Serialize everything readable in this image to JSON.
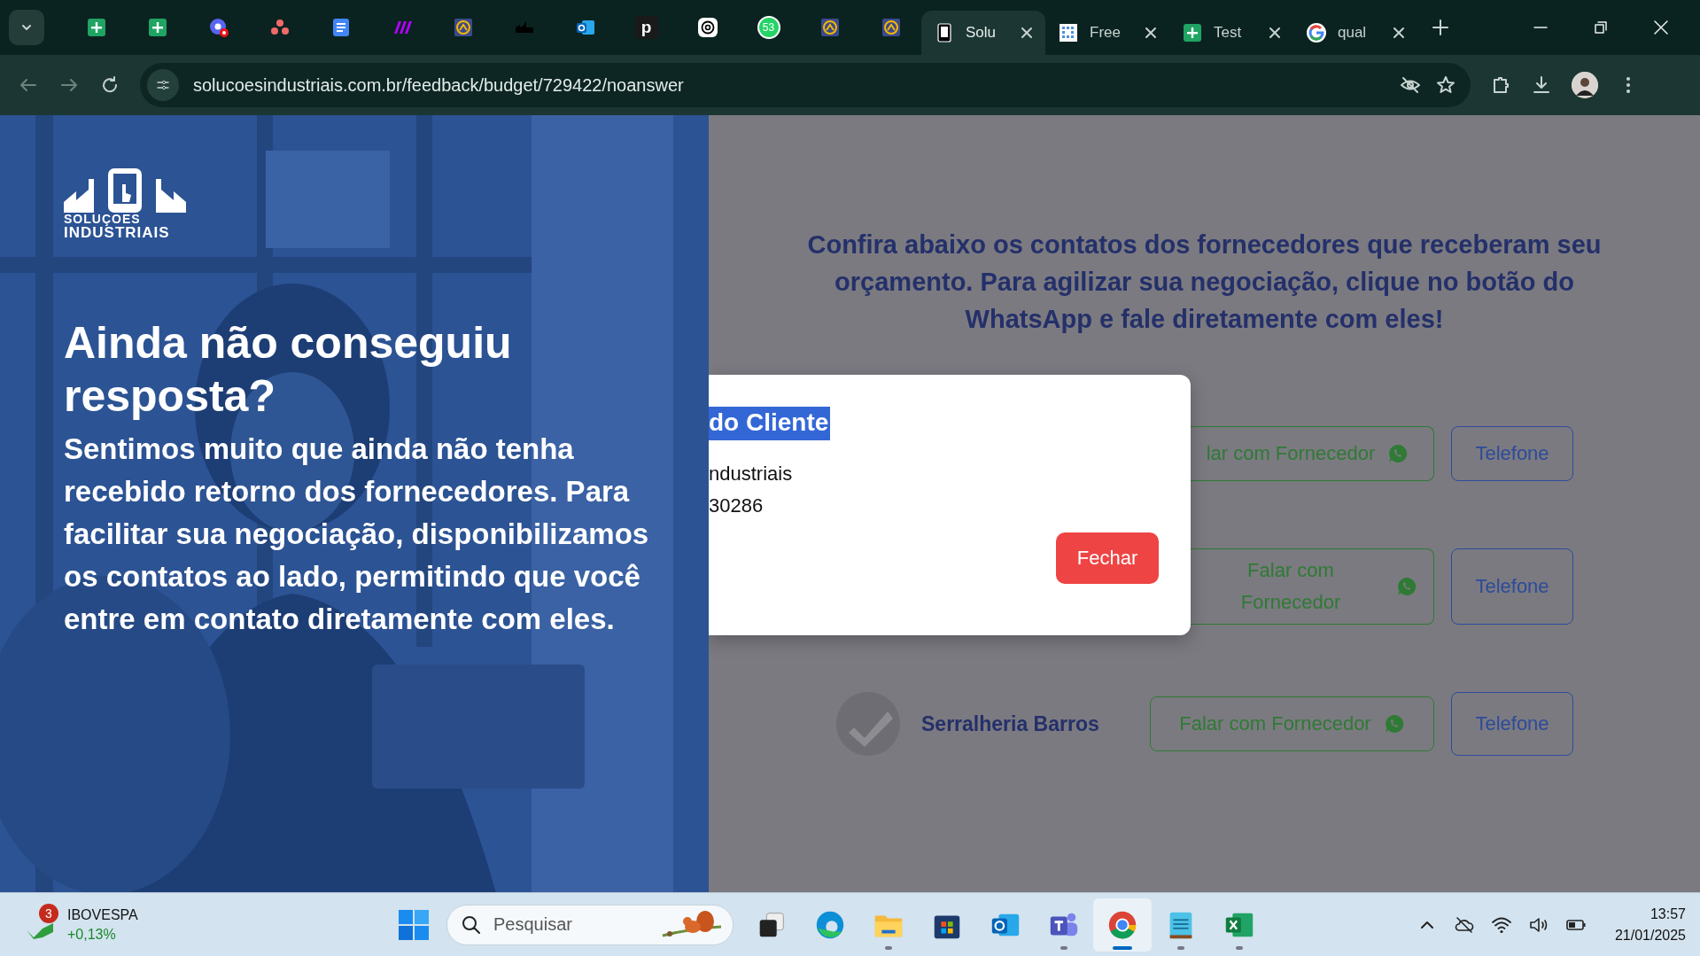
{
  "browser": {
    "pinned_tabs": [
      {
        "kind": "sheet"
      },
      {
        "kind": "sheet"
      },
      {
        "kind": "chat-alert"
      },
      {
        "kind": "dots"
      },
      {
        "kind": "doc"
      },
      {
        "kind": "stripes"
      },
      {
        "kind": "gauge"
      },
      {
        "kind": "factory"
      },
      {
        "kind": "mail"
      },
      {
        "kind": "letter",
        "label": "p"
      },
      {
        "kind": "knot"
      },
      {
        "kind": "bubble",
        "label": "53"
      },
      {
        "kind": "gauge"
      },
      {
        "kind": "gauge"
      }
    ],
    "tabs": [
      {
        "kind": "phone",
        "title": "Solu",
        "selected": true
      },
      {
        "kind": "grid",
        "title": "Free",
        "selected": false
      },
      {
        "kind": "sheet",
        "title": "Test",
        "selected": false
      },
      {
        "kind": "g",
        "title": "qual",
        "selected": false
      }
    ],
    "url": "solucoesindustriais.com.br/feedback/budget/729422/noanswer"
  },
  "hero": {
    "logo_top": "SOLUÇOES",
    "logo_bottom": "INDUSTRIAIS",
    "title": "Ainda não conseguiu resposta?",
    "text": "Sentimos muito que ainda não tenha recebido retorno dos fornecedores. Para facilitar sua negociação, disponibilizamos os contatos ao lado, permitindo que você entre em contato diretamente com eles."
  },
  "main": {
    "heading": "Confira abaixo os contatos dos fornecedores que receberam seu orçamento. Para agilizar sua negociação, clique no botão do WhatsApp e fale diretamente com eles!",
    "suppliers": [
      {
        "kind": "covered",
        "whatsapp": "lar com Fornecedor",
        "phone": "Telefone"
      },
      {
        "kind": "covered",
        "whatsapp": "Falar com Fornecedor",
        "phone": "Telefone"
      },
      {
        "kind": "full",
        "name": "Serralheria Barros",
        "whatsapp": "Falar com Fornecedor",
        "phone": "Telefone"
      }
    ]
  },
  "dialog": {
    "title": "do Cliente",
    "lines": [
      "ndustriais",
      "30286"
    ],
    "button": "Fechar"
  },
  "taskbar": {
    "widget": {
      "badge": "3",
      "name": "IBOVESPA",
      "change": "+0,13%"
    },
    "search": {
      "placeholder": "Pesquisar"
    },
    "apps": [
      {
        "kind": "taskview",
        "running": false,
        "selected": false
      },
      {
        "kind": "edge",
        "running": false,
        "selected": false
      },
      {
        "kind": "folder",
        "running": true,
        "selected": false
      },
      {
        "kind": "store",
        "running": false,
        "selected": false
      },
      {
        "kind": "mail",
        "running": false,
        "selected": false
      },
      {
        "kind": "team",
        "running": true,
        "selected": false
      },
      {
        "kind": "chrome",
        "running": true,
        "selected": true
      },
      {
        "kind": "notepad",
        "running": true,
        "selected": false
      },
      {
        "kind": "sheet",
        "running": true,
        "selected": false
      }
    ],
    "time": "13:57",
    "date": "21/01/2025"
  }
}
